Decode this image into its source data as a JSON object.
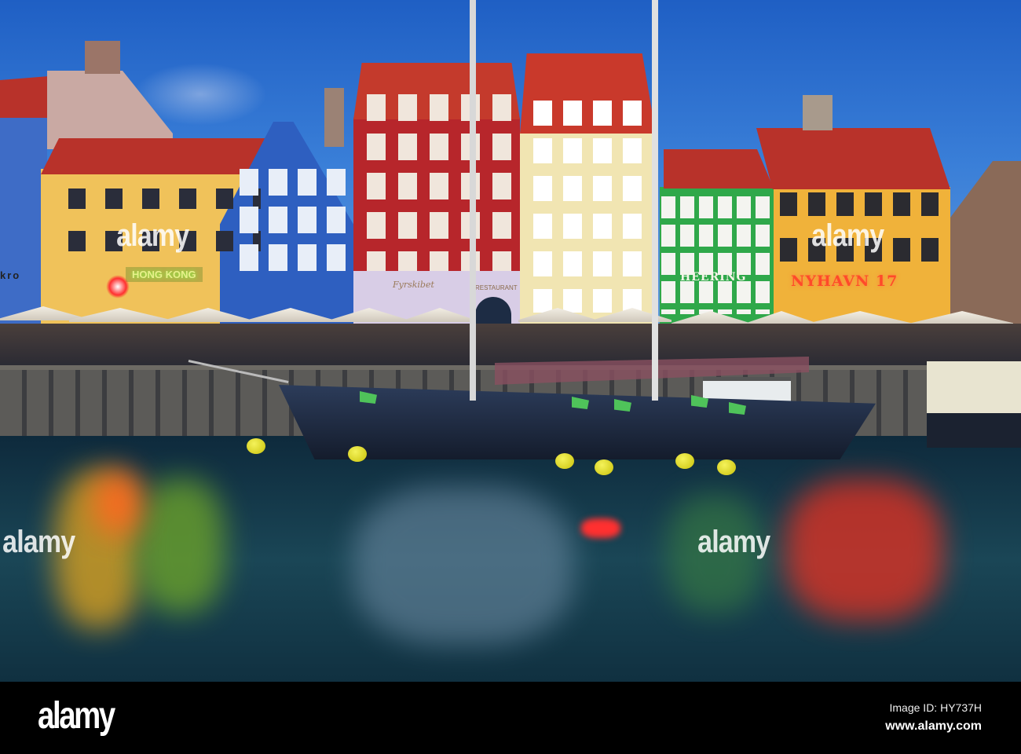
{
  "signs": {
    "hong_kong": "HONG KONG",
    "heering": "HEERING",
    "nyhavn": "NYHAVN 17",
    "fyrskibet": "Fyrskibet",
    "restaurant": "RESTAURANT",
    "kro": "kro"
  },
  "watermark": {
    "text": "alamy"
  },
  "footer": {
    "logo": "alamy",
    "image_id": "Image ID: HY737H",
    "url": "www.alamy.com"
  },
  "colors": {
    "sky": "#2a6cd0",
    "water": "#14394a",
    "footer": "#000000"
  }
}
